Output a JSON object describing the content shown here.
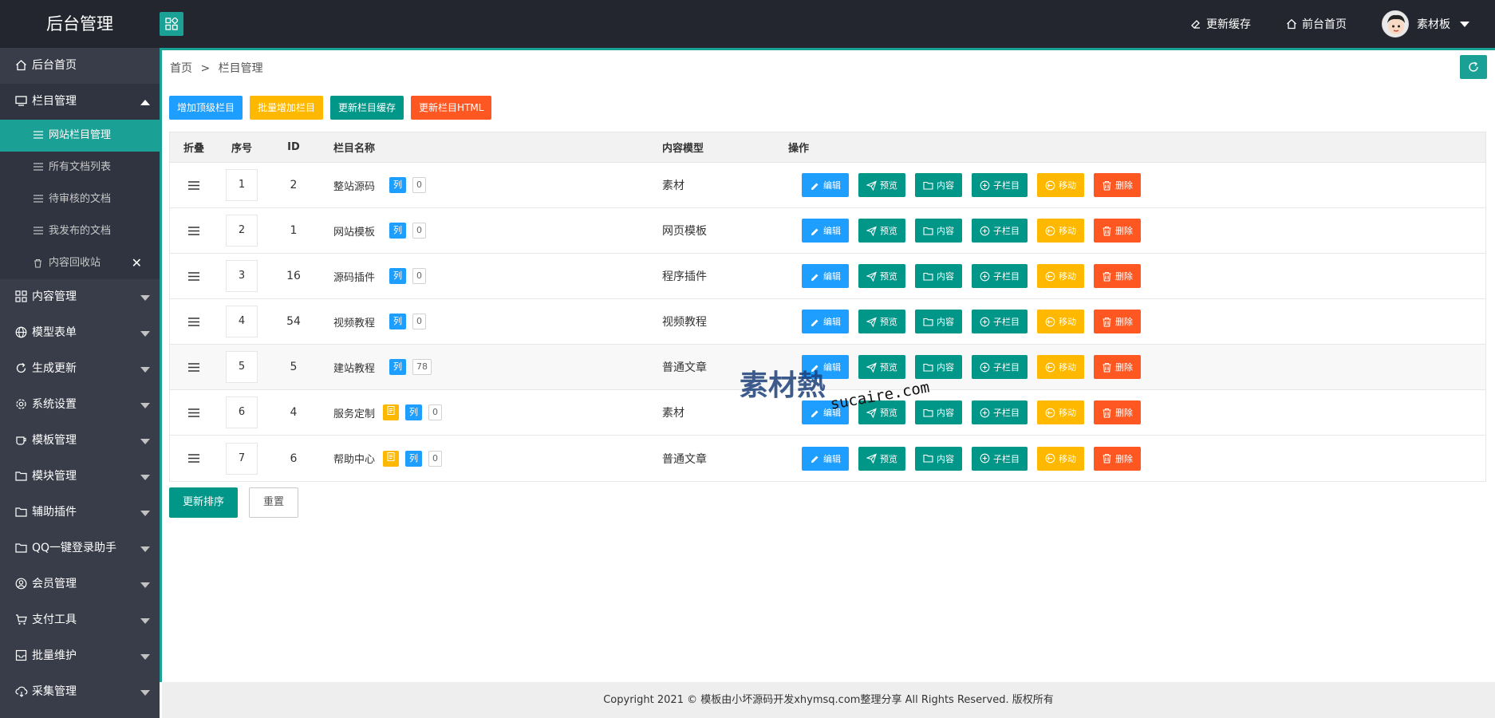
{
  "header": {
    "title": "后台管理",
    "clear_cache": "更新缓存",
    "frontend_home": "前台首页",
    "username": "素材板"
  },
  "sidebar": {
    "items": [
      {
        "label": "后台首页",
        "icon": "home-icon"
      },
      {
        "label": "栏目管理",
        "icon": "monitor-icon",
        "expanded": true,
        "children": [
          {
            "label": "网站栏目管理",
            "active": true
          },
          {
            "label": "所有文档列表"
          },
          {
            "label": "待审核的文档"
          },
          {
            "label": "我发布的文档"
          },
          {
            "label": "内容回收站",
            "icon": "trash-icon",
            "close": "✕"
          }
        ]
      },
      {
        "label": "内容管理",
        "icon": "grid-icon"
      },
      {
        "label": "模型表单",
        "icon": "globe-icon"
      },
      {
        "label": "生成更新",
        "icon": "refresh-icon"
      },
      {
        "label": "系统设置",
        "icon": "gear-icon"
      },
      {
        "label": "模板管理",
        "icon": "cup-icon"
      },
      {
        "label": "模块管理",
        "icon": "folder-icon"
      },
      {
        "label": "辅助插件",
        "icon": "folder-icon"
      },
      {
        "label": "QQ一键登录助手",
        "icon": "folder-icon"
      },
      {
        "label": "会员管理",
        "icon": "user-circle-icon"
      },
      {
        "label": "支付工具",
        "icon": "cart-icon"
      },
      {
        "label": "批量维护",
        "icon": "box-icon"
      },
      {
        "label": "采集管理",
        "icon": "cloud-icon"
      }
    ]
  },
  "breadcrumb": {
    "home": "首页",
    "sep": ">",
    "current": "栏目管理"
  },
  "actions": {
    "add_top": "增加顶级栏目",
    "batch_add": "批量增加栏目",
    "update_cache": "更新栏目缓存",
    "update_html": "更新栏目HTML"
  },
  "table": {
    "headers": {
      "fold": "折叠",
      "order": "序号",
      "id": "ID",
      "name": "栏目名称",
      "model": "内容模型",
      "ops": "操作"
    },
    "list_badge": "列",
    "doc_badge": "📄",
    "ops": {
      "edit": "编辑",
      "preview": "预览",
      "content": "内容",
      "sub": "子栏目",
      "move": "移动",
      "delete": "删除"
    },
    "rows": [
      {
        "order": "1",
        "id": "2",
        "name": "整站源码",
        "count": "0",
        "model": "素材",
        "doc": false
      },
      {
        "order": "2",
        "id": "1",
        "name": "网站模板",
        "count": "0",
        "model": "网页模板",
        "doc": false
      },
      {
        "order": "3",
        "id": "16",
        "name": "源码插件",
        "count": "0",
        "model": "程序插件",
        "doc": false
      },
      {
        "order": "4",
        "id": "54",
        "name": "视频教程",
        "count": "0",
        "model": "视频教程",
        "doc": false
      },
      {
        "order": "5",
        "id": "5",
        "name": "建站教程",
        "count": "78",
        "model": "普通文章",
        "doc": false
      },
      {
        "order": "6",
        "id": "4",
        "name": "服务定制",
        "count": "0",
        "model": "素材",
        "doc": true
      },
      {
        "order": "7",
        "id": "6",
        "name": "帮助中心",
        "count": "0",
        "model": "普通文章",
        "doc": true
      }
    ]
  },
  "bottom": {
    "update_order": "更新排序",
    "reset": "重置"
  },
  "footer": {
    "text": "Copyright 2021 © 模板由小坏源码开发xhymsq.com整理分享 All Rights Reserved. 版权所有"
  },
  "watermark": {
    "main": "素材熱",
    "sub": "sucaire.com"
  }
}
